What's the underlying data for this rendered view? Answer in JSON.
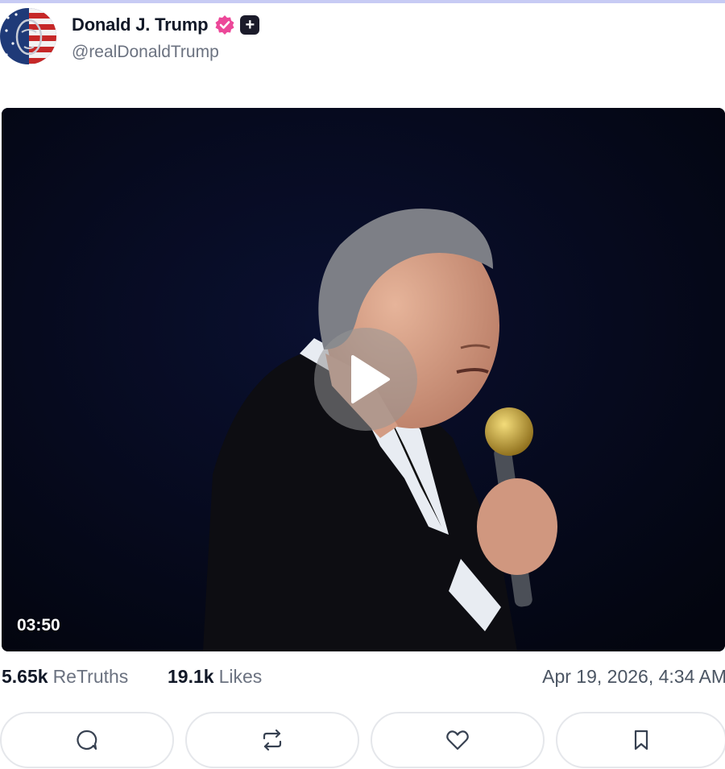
{
  "post": {
    "author": {
      "display_name": "Donald J. Trump",
      "handle": "@realDonaldTrump",
      "avatar_icon": "flag-portrait-avatar",
      "verified_icon": "verified-badge-icon",
      "plus_badge_icon": "plus-badge-icon"
    },
    "media": {
      "type": "video",
      "duration": "03:50",
      "play_icon": "play-icon"
    },
    "stats": {
      "retruths_count": "5.65k",
      "retruths_label": "ReTruths",
      "likes_count": "19.1k",
      "likes_label": "Likes",
      "timestamp": "Apr 19, 2026, 4:34 AM"
    },
    "actions": [
      {
        "name": "reply",
        "icon": "comment-icon"
      },
      {
        "name": "retruth",
        "icon": "repost-icon"
      },
      {
        "name": "like",
        "icon": "heart-icon"
      },
      {
        "name": "bookmark",
        "icon": "bookmark-icon"
      }
    ]
  },
  "colors": {
    "accent_rule": "#c7cbf4",
    "verified_pink": "#ec4899",
    "muted_text": "#6b7280",
    "border": "#e5e7eb"
  }
}
